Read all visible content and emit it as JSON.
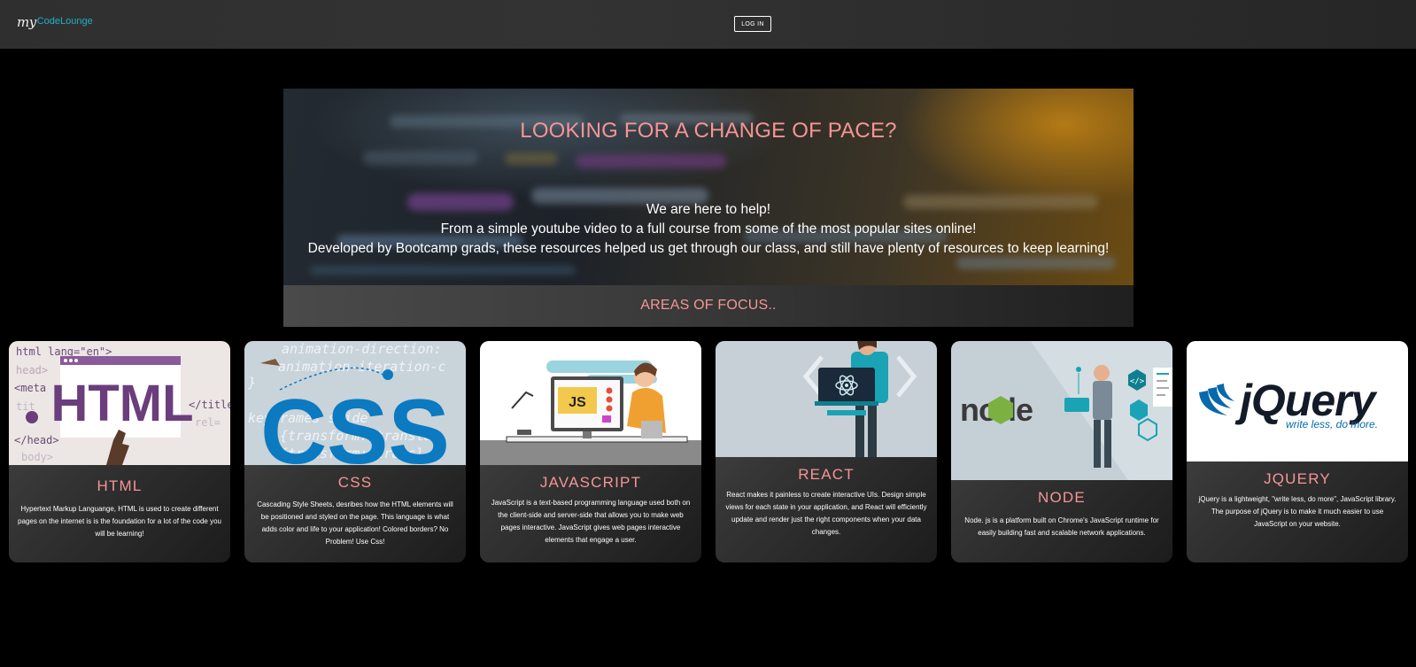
{
  "nav": {
    "logo_my": "my",
    "logo_brand": "CodeLounge",
    "login_label": "LOG IN"
  },
  "hero": {
    "title": "LOOKING FOR A CHANGE OF PACE?",
    "lines": [
      "We are here to help!",
      "From a simple youtube video to a full course from some of the most popular sites online!",
      "Developed by Bootcamp grads, these resources helped us get through our class, and still have plenty of resources to keep learning!"
    ],
    "focus_title": "AREAS OF FOCUS.."
  },
  "colors": {
    "accent_pink": "#f59595",
    "logo_teal": "#1fb0c8",
    "html_purple": "#6b3d7d",
    "css_blue": "#0b7ac0",
    "jquery_blue": "#0769ad",
    "node_green": "#7ab140"
  },
  "cards": [
    {
      "icon": "html-logo-icon",
      "image_text": "HTML",
      "code_snippets": [
        "html lang=\"en\">",
        "head>",
        "<meta",
        "tit",
        "</title",
        "rel=",
        "</head>",
        "body>"
      ],
      "title": "HTML",
      "description": "Hypertext Markup Languange, HTML is used to create different pages on the internet is is the foundation for a lot of the code you will be learning!"
    },
    {
      "icon": "css-logo-icon",
      "image_text": "CSS",
      "code_snippets": [
        "animation-direction:",
        "animation-iteration-c",
        "}",
        "keyframes slide",
        "{transform: transla",
        "{transform: transl"
      ],
      "title": "CSS",
      "description": "Cascading Style Sheets, desribes how the HTML elements will be positioned and styled on the page. This language is what adds color and life to your application! Colored borders? No Problem! Use Css!"
    },
    {
      "icon": "javascript-developer-icon",
      "image_text": "JS",
      "title": "JAVASCRIPT",
      "description": "JavaScript is a text-based programming language used both on the client-side and server-side that allows you to make web pages interactive. JavaScript gives web pages interactive elements that engage a user."
    },
    {
      "icon": "react-presenter-icon",
      "title": "REACT",
      "description": "React makes it painless to create interactive UIs. Design simple views for each state in your application, and React will efficiently update and render just the right components when your data changes."
    },
    {
      "icon": "node-logo-icon",
      "image_text": "node",
      "title": "NODE",
      "description": "Node. js is a platform built on Chrome's JavaScript runtime for easily building fast and scalable network applications."
    },
    {
      "icon": "jquery-logo-icon",
      "image_text": "jQuery",
      "image_tagline": "write less, do more.",
      "title": "JQUERY",
      "description": "jQuery is a lightweight, \"write less, do more\", JavaScript library. The purpose of jQuery is to make it much easier to use JavaScript on your website."
    }
  ]
}
